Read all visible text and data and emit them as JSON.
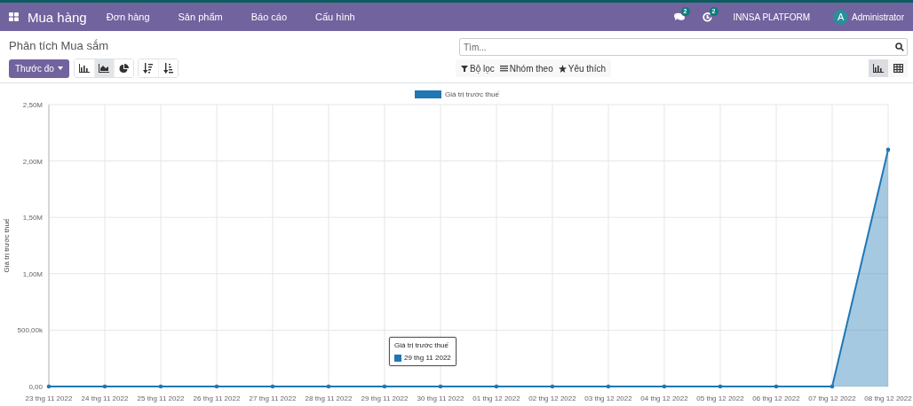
{
  "navbar": {
    "app_name": "Mua hàng",
    "menu": [
      {
        "label": "Đơn hàng"
      },
      {
        "label": "Sản phẩm"
      },
      {
        "label": "Báo cáo"
      },
      {
        "label": "Cấu hình"
      }
    ],
    "systray": {
      "messages_badge": "2",
      "activities_badge": "2",
      "company": "INNSA PLATFORM",
      "user": {
        "avatar_letter": "A",
        "name": "Administrator"
      }
    }
  },
  "control_panel": {
    "breadcrumb": "Phân tích Mua sắm",
    "search": {
      "placeholder": "Tìm..."
    },
    "measures_button": "Thước đo",
    "chart_types": [
      {
        "kind": "bar",
        "selected": false
      },
      {
        "kind": "line",
        "selected": true
      },
      {
        "kind": "pie",
        "selected": false
      }
    ],
    "sort_buttons": [
      {
        "kind": "descending"
      },
      {
        "kind": "ascending"
      }
    ],
    "filters": [
      {
        "kind": "filter",
        "label": "Bộ lọc"
      },
      {
        "kind": "group",
        "label": "Nhóm theo"
      },
      {
        "kind": "favorite",
        "label": "Yêu thích"
      }
    ],
    "views": [
      {
        "kind": "graph",
        "selected": true
      },
      {
        "kind": "pivot",
        "selected": false
      }
    ]
  },
  "chart": {
    "chart_data": {
      "type": "area",
      "ylabel": "Giá trị trước thuế",
      "categories": [
        "23 thg 11 2022",
        "24 thg 11 2022",
        "25 thg 11 2022",
        "26 thg 11 2022",
        "27 thg 11 2022",
        "28 thg 11 2022",
        "29 thg 11 2022",
        "30 thg 11 2022",
        "01 thg 12 2022",
        "02 thg 12 2022",
        "03 thg 12 2022",
        "04 thg 12 2022",
        "05 thg 12 2022",
        "06 thg 12 2022",
        "07 thg 12 2022",
        "08 thg 12 2022"
      ],
      "series": [
        {
          "name": "Giá trị trước thuế",
          "color": "#1f77b4",
          "values": [
            0,
            0,
            0,
            0,
            0,
            0,
            0,
            0,
            0,
            0,
            0,
            0,
            0,
            0,
            0,
            2100000
          ]
        }
      ],
      "ylim": [
        0,
        2500000
      ],
      "grid": true,
      "yticks": [
        {
          "value": 0,
          "label": "0,00"
        },
        {
          "value": 500000,
          "label": "500,00k"
        },
        {
          "value": 1000000,
          "label": "1,00M"
        },
        {
          "value": 1500000,
          "label": "1,50M"
        },
        {
          "value": 2000000,
          "label": "2,00M"
        },
        {
          "value": 2500000,
          "label": "2,50M"
        }
      ]
    },
    "tooltip": {
      "title": "Giá trị trước thuế",
      "item": "29 thg 11 2022"
    }
  }
}
